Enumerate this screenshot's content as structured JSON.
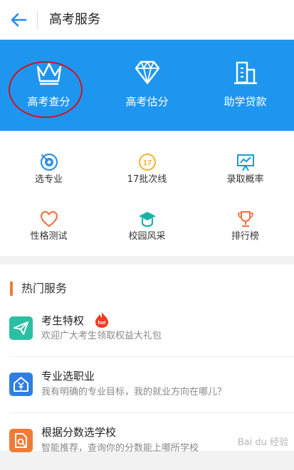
{
  "header": {
    "title": "高考服务",
    "back_icon": "arrow-left-icon"
  },
  "banner": {
    "bg_color": "#1e96f0",
    "items": [
      {
        "label": "高考查分",
        "icon": "crown-icon"
      },
      {
        "label": "高考估分",
        "icon": "diamond-icon"
      },
      {
        "label": "助学贷款",
        "icon": "building-icon"
      }
    ]
  },
  "grid": {
    "items": [
      {
        "label": "选专业",
        "icon": "target-icon"
      },
      {
        "label": "17批次线",
        "icon": "calendar-17-icon"
      },
      {
        "label": "录取概率",
        "icon": "chart-board-icon"
      },
      {
        "label": "性格测试",
        "icon": "heart-icon"
      },
      {
        "label": "校园风采",
        "icon": "graduation-cap-icon"
      },
      {
        "label": "排行榜",
        "icon": "trophy-icon"
      }
    ]
  },
  "hot": {
    "title": "热门服务",
    "accent": "#f07b35",
    "items": [
      {
        "title": "考生特权",
        "subtitle": "欢迎广大考生领取权益大礼包",
        "icon": "paper-plane-icon",
        "badge": "hot"
      },
      {
        "title": "专业选职业",
        "subtitle": "我有明确的专业目标，我的就业方向在哪儿？",
        "icon": "house-yen-icon"
      },
      {
        "title": "根据分数选学校",
        "subtitle": "智能推荐，查询你的分数能上哪所学校",
        "icon": "document-search-icon"
      }
    ]
  },
  "watermark": "Bai du 经验"
}
